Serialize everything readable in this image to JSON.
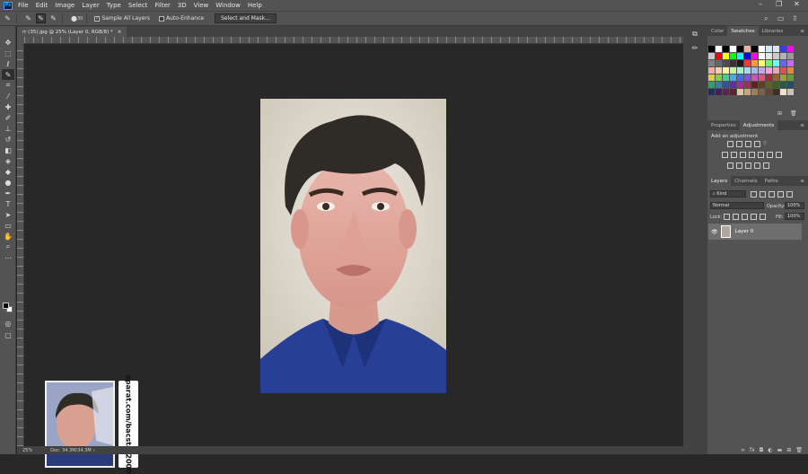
{
  "app": {
    "logo": "Ps"
  },
  "menu": [
    "File",
    "Edit",
    "Image",
    "Layer",
    "Type",
    "Select",
    "Filter",
    "3D",
    "View",
    "Window",
    "Help"
  ],
  "window_controls": {
    "min": "–",
    "max": "❐",
    "close": "✕"
  },
  "options_bar": {
    "sample_all_layers": "Sample All Layers",
    "auto_enhance": "Auto-Enhance",
    "select_and_mask": "Select and Mask...",
    "brush_size": "30"
  },
  "document": {
    "tab_label": "rr (35).jpg @ 25% (Layer 0, RGB/8) *",
    "tab_close": "×"
  },
  "status": {
    "zoom": "25%",
    "doc_size": "Doc: 34.3M/34.3M"
  },
  "overlay": {
    "watermark": "aparat.com/bacstar2000"
  },
  "panels": {
    "top_tabs": [
      "Color",
      "Swatches",
      "Libraries"
    ],
    "mid_tabs": [
      "Properties",
      "Adjustments"
    ],
    "add_adjustment": "Add an adjustment",
    "layers_tabs": [
      "Layers",
      "Channels",
      "Paths"
    ],
    "kind_label": "Kind",
    "blend_mode": "Normal",
    "opacity_label": "Opacity:",
    "opacity_value": "100%",
    "lock_label": "Lock:",
    "fill_label": "Fill:",
    "fill_value": "100%",
    "layer_name": "Layer 0"
  },
  "swatches": [
    "#000000",
    "#ffffff",
    "#000000",
    "#ffffff",
    "#000000",
    "#e8b0a0",
    "#000000",
    "#ffffff",
    "#cfe9f5",
    "#e0e0ff",
    "#3a3aff",
    "#ff00ff",
    "#c8c8c8",
    "#ff0000",
    "#ffff00",
    "#00ff00",
    "#00ffff",
    "#0000ff",
    "#ff00ff",
    "#ffffff",
    "#e6e6e6",
    "#cccccc",
    "#b3b3b3",
    "#999999",
    "#808080",
    "#666666",
    "#4d4d4d",
    "#333333",
    "#1a1a1a",
    "#ff3333",
    "#ff9933",
    "#ffff66",
    "#66ff66",
    "#66ffff",
    "#6666ff",
    "#cc66ff",
    "#f7a8a8",
    "#f9cfa0",
    "#fbf2a3",
    "#c7f0a3",
    "#a3f0d4",
    "#a3d9f0",
    "#a3b8f0",
    "#c2a3f0",
    "#f0a3e0",
    "#f0a3b8",
    "#e05050",
    "#e08a40",
    "#e0d040",
    "#80d040",
    "#40d090",
    "#40b0e0",
    "#4070e0",
    "#8050e0",
    "#d050c0",
    "#e05080",
    "#a03030",
    "#a06030",
    "#a0a030",
    "#60a030",
    "#30a070",
    "#3080a0",
    "#3050a0",
    "#6030a0",
    "#a03090",
    "#a03050",
    "#602020",
    "#604020",
    "#606020",
    "#406020",
    "#206040",
    "#205060",
    "#203060",
    "#402060",
    "#602050",
    "#602030",
    "#e0c8a0",
    "#c8a878",
    "#a08050",
    "#806040",
    "#604830",
    "#403020",
    "#f0e0d0",
    "#d0c0b0"
  ]
}
